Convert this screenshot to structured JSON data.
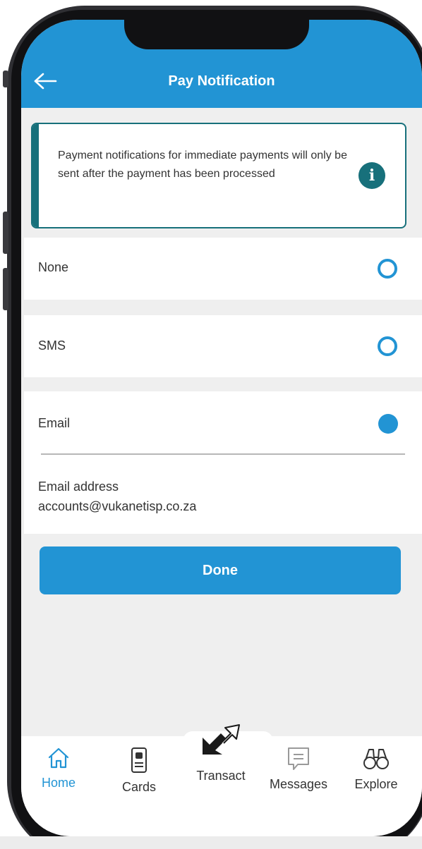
{
  "header": {
    "title": "Pay Notification",
    "back_icon": "arrow-left-icon"
  },
  "info": {
    "text": "Payment notifications for immediate payments will only be sent after the payment has been processed",
    "icon": "info-icon",
    "accent_color": "#17707b"
  },
  "options": [
    {
      "label": "None",
      "selected": false
    },
    {
      "label": "SMS",
      "selected": false
    },
    {
      "label": "Email",
      "selected": true
    }
  ],
  "email": {
    "label": "Email address",
    "value": "accounts@vukanetisp.co.za"
  },
  "done_button": {
    "label": "Done"
  },
  "nav": {
    "items": [
      {
        "label": "Home",
        "icon": "home-icon",
        "active": true
      },
      {
        "label": "Cards",
        "icon": "card-icon",
        "active": false
      },
      {
        "label": "Transact",
        "icon": "transact-arrows-icon",
        "active": false
      },
      {
        "label": "Messages",
        "icon": "message-icon",
        "active": false
      },
      {
        "label": "Explore",
        "icon": "binoculars-icon",
        "active": false
      }
    ]
  },
  "colors": {
    "primary": "#2294d4",
    "teal": "#17707b",
    "background": "#efefef"
  }
}
